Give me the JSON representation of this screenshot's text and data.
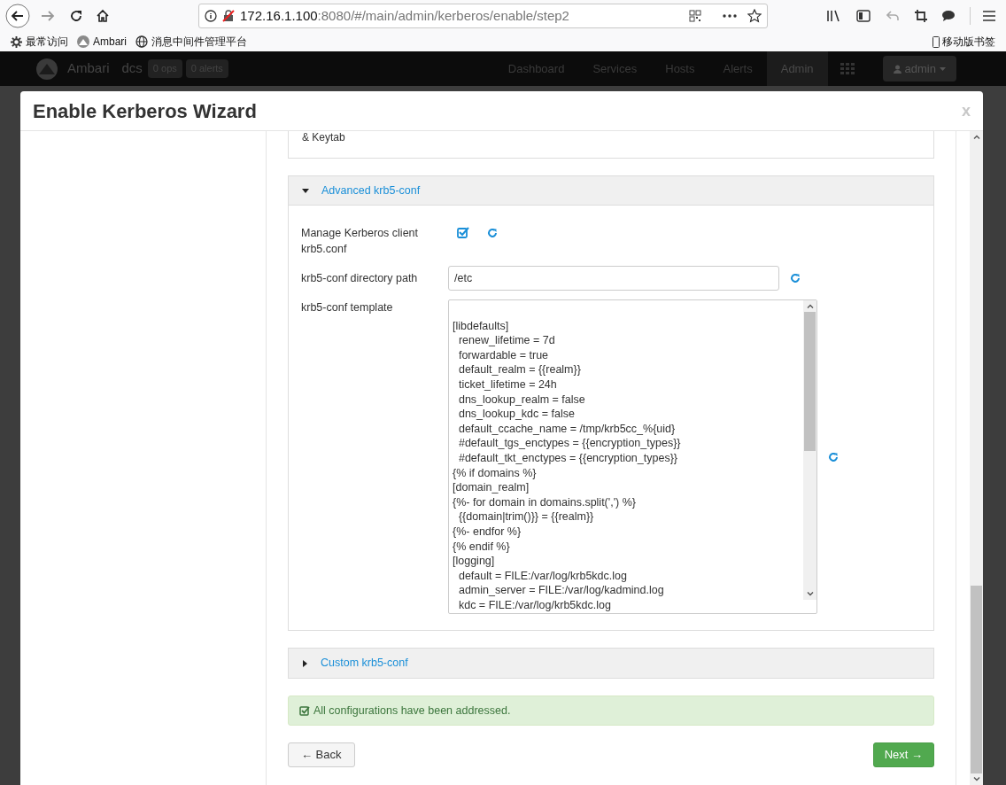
{
  "browser": {
    "url_host": "172.16.1.100",
    "url_rest": ":8080/#/main/admin/kerberos/enable/step2",
    "bookmarks": [
      {
        "kind": "gear",
        "label": "最常访问"
      },
      {
        "kind": "ambari",
        "label": "Ambari"
      },
      {
        "kind": "globe",
        "label": "消息中间件管理平台"
      }
    ],
    "mobile_bookmarks": "移动版书签"
  },
  "app_nav": {
    "brand": "Ambari",
    "cluster": "dcs",
    "ops_badge": "0 ops",
    "alerts_badge": "0 alerts",
    "items": [
      {
        "label": "Dashboard",
        "selected": false
      },
      {
        "label": "Services",
        "selected": false
      },
      {
        "label": "Hosts",
        "selected": false
      },
      {
        "label": "Alerts",
        "selected": false
      },
      {
        "label": "Admin",
        "selected": true
      }
    ],
    "user": "admin"
  },
  "modal": {
    "title": "Enable Kerberos Wizard",
    "close": "x",
    "partial_text": "& Keytab",
    "sections": [
      {
        "title": "Advanced krb5-conf",
        "expanded": true,
        "fields": [
          {
            "kind": "checkbox",
            "label": "Manage Kerberos client krb5.conf",
            "checked": true
          },
          {
            "kind": "text",
            "label": "krb5-conf directory path",
            "value": "/etc"
          },
          {
            "kind": "textarea",
            "label": "krb5-conf template",
            "value": "\n[libdefaults]\n  renew_lifetime = 7d\n  forwardable = true\n  default_realm = {{realm}}\n  ticket_lifetime = 24h\n  dns_lookup_realm = false\n  dns_lookup_kdc = false\n  default_ccache_name = /tmp/krb5cc_%{uid}\n  #default_tgs_enctypes = {{encryption_types}}\n  #default_tkt_enctypes = {{encryption_types}}\n{% if domains %}\n[domain_realm]\n{%- for domain in domains.split(',') %}\n  {{domain|trim()}} = {{realm}}\n{%- endfor %}\n{% endif %}\n[logging]\n  default = FILE:/var/log/krb5kdc.log\n  admin_server = FILE:/var/log/kadmind.log\n  kdc = FILE:/var/log/krb5kdc.log"
          }
        ]
      },
      {
        "title": "Custom krb5-conf",
        "expanded": false
      }
    ],
    "alert": "All configurations have been addressed.",
    "back": "← Back",
    "next": "Next →"
  }
}
